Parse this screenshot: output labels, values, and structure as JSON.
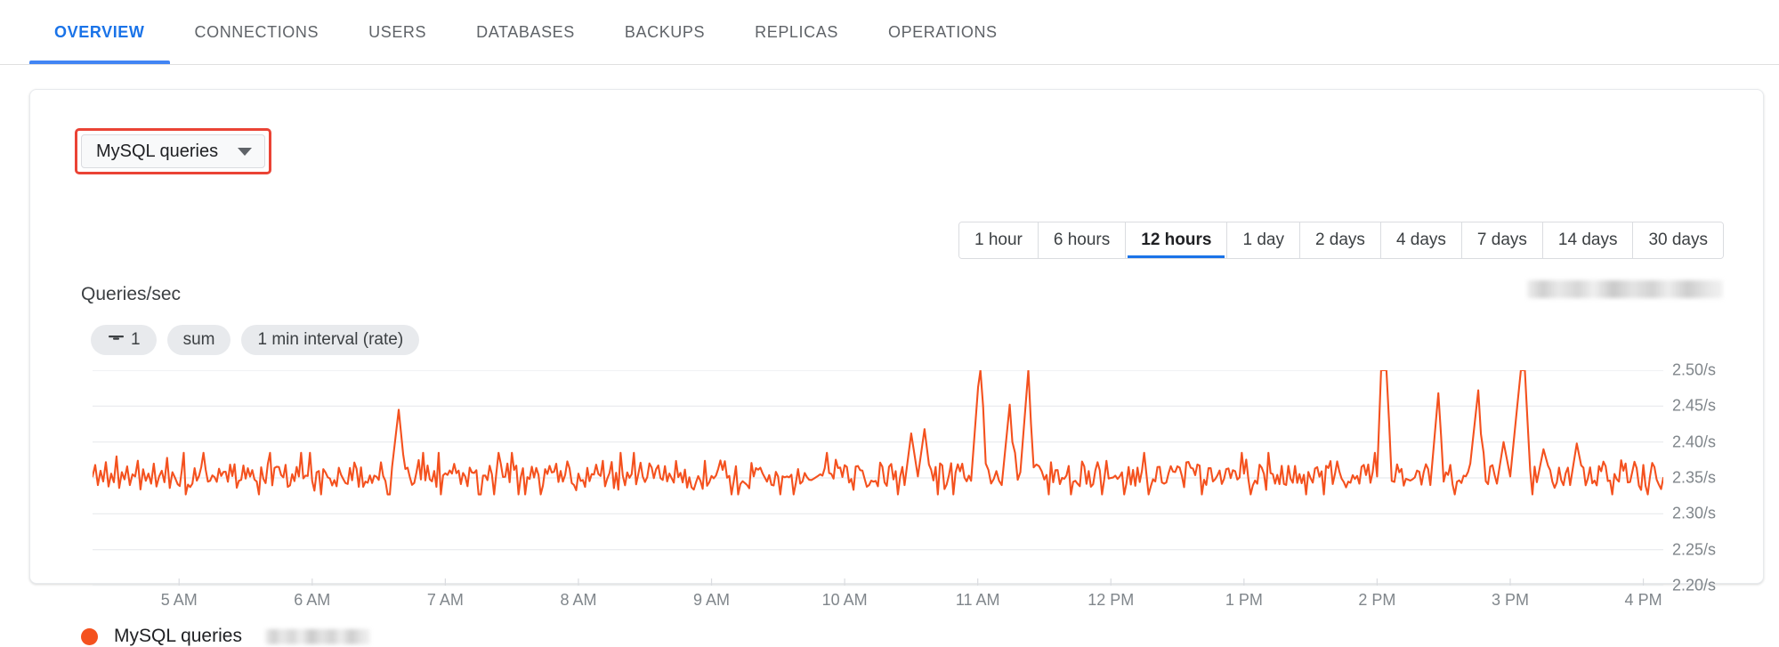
{
  "tabs": [
    {
      "label": "OVERVIEW",
      "active": true
    },
    {
      "label": "CONNECTIONS",
      "active": false
    },
    {
      "label": "USERS",
      "active": false
    },
    {
      "label": "DATABASES",
      "active": false
    },
    {
      "label": "BACKUPS",
      "active": false
    },
    {
      "label": "REPLICAS",
      "active": false
    },
    {
      "label": "OPERATIONS",
      "active": false
    }
  ],
  "metric_selector": {
    "label": "MySQL queries",
    "icon": "chevron-down-icon",
    "highlight_color": "#ea4335"
  },
  "time_range": {
    "options": [
      "1 hour",
      "6 hours",
      "12 hours",
      "1 day",
      "2 days",
      "4 days",
      "7 days",
      "14 days",
      "30 days"
    ],
    "selected": "12 hours",
    "accent_color": "#1a73e8"
  },
  "chart_header": {
    "title": "Queries/sec",
    "redacted_value": "",
    "chips": [
      {
        "icon": "filter-icon",
        "label": "1"
      },
      {
        "icon": "",
        "label": "sum"
      },
      {
        "icon": "",
        "label": "1 min interval (rate)"
      }
    ]
  },
  "legend": {
    "series_label": "MySQL queries",
    "redacted_suffix": "",
    "color": "#f4511e"
  },
  "chart_data": {
    "type": "line",
    "title": "Queries/sec",
    "xlabel": "",
    "ylabel": "Queries/sec",
    "unit": "/s",
    "grid": true,
    "legend_position": "bottom-left",
    "line_color": "#f4511e",
    "ylim": [
      2.2,
      2.5
    ],
    "yticks": [
      2.5,
      2.45,
      2.4,
      2.35,
      2.3,
      2.25,
      2.2
    ],
    "ytick_labels": [
      "2.50/s",
      "2.45/s",
      "2.40/s",
      "2.35/s",
      "2.30/s",
      "2.25/s",
      "2.20/s"
    ],
    "xtick_labels": [
      "5 AM",
      "6 AM",
      "7 AM",
      "8 AM",
      "9 AM",
      "10 AM",
      "11 AM",
      "12 PM",
      "1 PM",
      "2 PM",
      "3 PM",
      "4 PM"
    ],
    "xlim_hours": [
      4.35,
      16.15
    ],
    "series": [
      {
        "name": "MySQL queries",
        "color": "#f4511e",
        "interval": "1 min (rate)",
        "baseline": 2.355,
        "noise_amplitude": 0.018,
        "points": [
          [
            4.35,
            2.352
          ],
          [
            4.37,
            2.368
          ],
          [
            4.39,
            2.34
          ],
          [
            4.41,
            2.36
          ],
          [
            4.43,
            2.345
          ],
          [
            4.45,
            2.372
          ],
          [
            4.47,
            2.338
          ],
          [
            4.49,
            2.356
          ],
          [
            4.51,
            2.344
          ],
          [
            4.53,
            2.38
          ],
          [
            4.55,
            2.336
          ],
          [
            4.57,
            2.358
          ],
          [
            4.59,
            2.348
          ],
          [
            4.61,
            2.366
          ],
          [
            4.63,
            2.34
          ],
          [
            4.65,
            2.355
          ],
          [
            4.67,
            2.352
          ],
          [
            4.69,
            2.374
          ],
          [
            4.71,
            2.334
          ],
          [
            4.73,
            2.362
          ],
          [
            4.75,
            2.346
          ],
          [
            4.77,
            2.356
          ],
          [
            4.79,
            2.342
          ],
          [
            4.81,
            2.37
          ],
          [
            4.83,
            2.338
          ],
          [
            4.85,
            2.352
          ],
          [
            4.87,
            2.36
          ],
          [
            4.89,
            2.344
          ],
          [
            4.91,
            2.378
          ],
          [
            4.93,
            2.336
          ],
          [
            4.95,
            2.358
          ],
          [
            4.97,
            2.35
          ],
          [
            4.99,
            2.354
          ],
          [
            5.05,
            2.352
          ],
          [
            5.1,
            2.352
          ],
          [
            5.15,
            2.366
          ],
          [
            5.2,
            2.34
          ],
          [
            5.25,
            2.358
          ],
          [
            5.3,
            2.346
          ],
          [
            5.35,
            2.37
          ],
          [
            5.4,
            2.336
          ],
          [
            5.45,
            2.356
          ],
          [
            5.5,
            2.348
          ],
          [
            5.55,
            2.362
          ],
          [
            5.6,
            2.342
          ],
          [
            5.65,
            2.355
          ],
          [
            5.7,
            2.352
          ],
          [
            5.75,
            2.368
          ],
          [
            5.8,
            2.338
          ],
          [
            5.85,
            2.358
          ],
          [
            5.9,
            2.346
          ],
          [
            5.95,
            2.374
          ],
          [
            6.0,
            2.334
          ],
          [
            6.05,
            2.356
          ],
          [
            6.1,
            2.35
          ],
          [
            6.15,
            2.362
          ],
          [
            6.2,
            2.344
          ],
          [
            6.25,
            2.352
          ],
          [
            6.3,
            2.358
          ],
          [
            6.35,
            2.34
          ],
          [
            6.4,
            2.376
          ],
          [
            6.45,
            2.336
          ],
          [
            6.5,
            2.354
          ],
          [
            6.55,
            2.35
          ],
          [
            6.6,
            2.365
          ],
          [
            6.65,
            2.445
          ],
          [
            6.7,
            2.352
          ],
          [
            6.75,
            2.342
          ],
          [
            6.8,
            2.358
          ],
          [
            6.85,
            2.346
          ],
          [
            6.9,
            2.368
          ],
          [
            6.95,
            2.338
          ],
          [
            7.0,
            2.356
          ],
          [
            7.05,
            2.35
          ],
          [
            7.1,
            2.372
          ],
          [
            7.15,
            2.334
          ],
          [
            7.2,
            2.358
          ],
          [
            7.25,
            2.348
          ],
          [
            7.3,
            2.362
          ],
          [
            7.35,
            2.344
          ],
          [
            7.4,
            2.352
          ],
          [
            7.45,
            2.356
          ],
          [
            7.5,
            2.34
          ],
          [
            7.55,
            2.374
          ],
          [
            7.6,
            2.336
          ],
          [
            7.65,
            2.354
          ],
          [
            7.7,
            2.35
          ],
          [
            7.75,
            2.366
          ],
          [
            7.8,
            2.342
          ],
          [
            7.85,
            2.358
          ],
          [
            7.9,
            2.348
          ],
          [
            7.95,
            2.37
          ],
          [
            8.0,
            2.338
          ],
          [
            8.05,
            2.356
          ],
          [
            8.1,
            2.352
          ],
          [
            8.15,
            2.36
          ],
          [
            8.2,
            2.344
          ],
          [
            8.25,
            2.355
          ],
          [
            8.3,
            2.352
          ],
          [
            8.35,
            2.372
          ],
          [
            8.4,
            2.336
          ],
          [
            8.45,
            2.358
          ],
          [
            8.5,
            2.346
          ],
          [
            8.55,
            2.368
          ],
          [
            8.6,
            2.34
          ],
          [
            8.65,
            2.356
          ],
          [
            8.7,
            2.35
          ],
          [
            8.75,
            2.364
          ],
          [
            8.8,
            2.342
          ],
          [
            8.85,
            2.354
          ],
          [
            8.9,
            2.358
          ],
          [
            8.95,
            2.338
          ],
          [
            9.0,
            2.376
          ],
          [
            9.05,
            2.334
          ],
          [
            9.1,
            2.356
          ],
          [
            9.15,
            2.35
          ],
          [
            9.2,
            2.368
          ],
          [
            9.25,
            2.344
          ],
          [
            9.3,
            2.358
          ],
          [
            9.35,
            2.348
          ],
          [
            9.4,
            2.37
          ],
          [
            9.45,
            2.336
          ],
          [
            9.5,
            2.354
          ],
          [
            9.55,
            2.352
          ],
          [
            9.6,
            2.366
          ],
          [
            9.65,
            2.34
          ],
          [
            9.7,
            2.358
          ],
          [
            9.75,
            2.346
          ],
          [
            9.8,
            2.372
          ],
          [
            9.85,
            2.338
          ],
          [
            9.9,
            2.356
          ],
          [
            9.95,
            2.35
          ],
          [
            10.0,
            2.362
          ],
          [
            10.05,
            2.344
          ],
          [
            10.1,
            2.355
          ],
          [
            10.15,
            2.352
          ],
          [
            10.2,
            2.374
          ],
          [
            10.25,
            2.336
          ],
          [
            10.3,
            2.358
          ],
          [
            10.35,
            2.346
          ],
          [
            10.4,
            2.368
          ],
          [
            10.45,
            2.34
          ],
          [
            10.5,
            2.412
          ],
          [
            10.55,
            2.352
          ],
          [
            10.6,
            2.418
          ],
          [
            10.65,
            2.344
          ],
          [
            10.7,
            2.36
          ],
          [
            10.75,
            2.342
          ],
          [
            10.8,
            2.358
          ],
          [
            10.85,
            2.35
          ],
          [
            10.9,
            2.366
          ],
          [
            10.95,
            2.346
          ],
          [
            11.02,
            2.52
          ],
          [
            11.06,
            2.38
          ],
          [
            11.1,
            2.352
          ],
          [
            11.14,
            2.372
          ],
          [
            11.18,
            2.34
          ],
          [
            11.24,
            2.452
          ],
          [
            11.28,
            2.348
          ],
          [
            11.32,
            2.358
          ],
          [
            11.38,
            2.5
          ],
          [
            11.42,
            2.35
          ],
          [
            11.46,
            2.344
          ],
          [
            11.5,
            2.36
          ],
          [
            11.55,
            2.348
          ],
          [
            11.6,
            2.366
          ],
          [
            11.65,
            2.34
          ],
          [
            11.7,
            2.358
          ],
          [
            11.75,
            2.35
          ],
          [
            11.8,
            2.37
          ],
          [
            11.85,
            2.336
          ],
          [
            11.9,
            2.356
          ],
          [
            11.95,
            2.352
          ],
          [
            12.0,
            2.362
          ],
          [
            12.05,
            2.344
          ],
          [
            12.1,
            2.355
          ],
          [
            12.15,
            2.352
          ],
          [
            12.2,
            2.368
          ],
          [
            12.25,
            2.338
          ],
          [
            12.3,
            2.358
          ],
          [
            12.35,
            2.348
          ],
          [
            12.4,
            2.372
          ],
          [
            12.45,
            2.34
          ],
          [
            12.5,
            2.356
          ],
          [
            12.55,
            2.35
          ],
          [
            12.6,
            2.364
          ],
          [
            12.65,
            2.342
          ],
          [
            12.7,
            2.354
          ],
          [
            12.75,
            2.358
          ],
          [
            12.8,
            2.338
          ],
          [
            12.85,
            2.374
          ],
          [
            12.9,
            2.336
          ],
          [
            12.95,
            2.356
          ],
          [
            13.0,
            2.35
          ],
          [
            13.05,
            2.366
          ],
          [
            13.1,
            2.344
          ],
          [
            13.15,
            2.358
          ],
          [
            13.2,
            2.348
          ],
          [
            13.25,
            2.37
          ],
          [
            13.3,
            2.338
          ],
          [
            13.35,
            2.354
          ],
          [
            13.4,
            2.352
          ],
          [
            13.45,
            2.368
          ],
          [
            13.5,
            2.34
          ],
          [
            13.55,
            2.358
          ],
          [
            13.6,
            2.346
          ],
          [
            13.65,
            2.372
          ],
          [
            13.7,
            2.338
          ],
          [
            13.75,
            2.356
          ],
          [
            13.8,
            2.35
          ],
          [
            13.85,
            2.362
          ],
          [
            13.9,
            2.344
          ],
          [
            13.95,
            2.355
          ],
          [
            14.0,
            2.352
          ],
          [
            14.03,
            2.5
          ],
          [
            14.07,
            2.5
          ],
          [
            14.11,
            2.356
          ],
          [
            14.15,
            2.372
          ],
          [
            14.2,
            2.342
          ],
          [
            14.25,
            2.358
          ],
          [
            14.3,
            2.348
          ],
          [
            14.35,
            2.366
          ],
          [
            14.4,
            2.34
          ],
          [
            14.46,
            2.468
          ],
          [
            14.5,
            2.352
          ],
          [
            14.55,
            2.344
          ],
          [
            14.6,
            2.36
          ],
          [
            14.65,
            2.346
          ],
          [
            14.7,
            2.37
          ],
          [
            14.76,
            2.472
          ],
          [
            14.8,
            2.35
          ],
          [
            14.85,
            2.358
          ],
          [
            14.9,
            2.342
          ],
          [
            14.95,
            2.4
          ],
          [
            15.0,
            2.352
          ],
          [
            15.05,
            2.445
          ],
          [
            15.08,
            2.5
          ],
          [
            15.11,
            2.5
          ],
          [
            15.15,
            2.358
          ],
          [
            15.2,
            2.344
          ],
          [
            15.25,
            2.39
          ],
          [
            15.3,
            2.356
          ],
          [
            15.35,
            2.348
          ],
          [
            15.4,
            2.368
          ],
          [
            15.45,
            2.34
          ],
          [
            15.5,
            2.398
          ],
          [
            15.55,
            2.352
          ],
          [
            15.6,
            2.358
          ],
          [
            15.65,
            2.346
          ],
          [
            15.7,
            2.37
          ],
          [
            15.75,
            2.338
          ],
          [
            15.8,
            2.356
          ],
          [
            15.85,
            2.35
          ],
          [
            15.9,
            2.364
          ],
          [
            15.95,
            2.344
          ],
          [
            16.0,
            2.378
          ],
          [
            16.05,
            2.352
          ],
          [
            16.1,
            2.358
          ],
          [
            16.15,
            2.35
          ]
        ]
      }
    ]
  }
}
